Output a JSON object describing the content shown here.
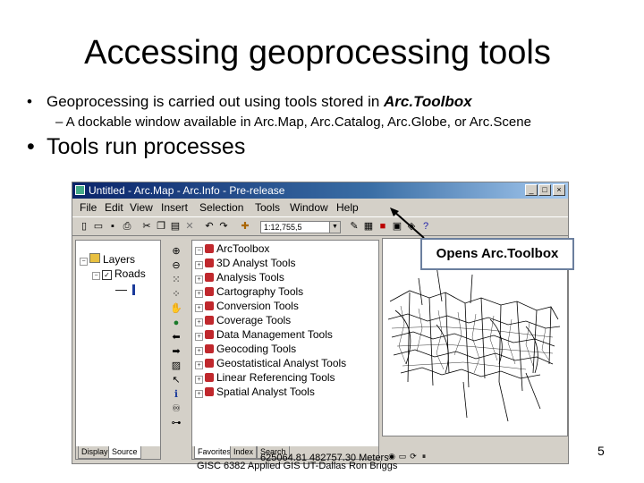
{
  "slide": {
    "title": "Accessing geoprocessing tools",
    "bullet1_prefix": "Geoprocessing is carried out using tools stored in ",
    "bullet1_emphasis": "Arc.Toolbox",
    "bullet2": "– A dockable window available in Arc.Map, Arc.Catalog, Arc.Globe, or Arc.Scene",
    "bullet3": "Tools run processes",
    "bullet_glyph": "•",
    "callout": "Opens Arc.Toolbox",
    "footer": "GISC 6382 Applied GIS   UT-Dallas   Ron Briggs",
    "page_number": "5"
  },
  "window": {
    "title": "Untitled - Arc.Map - Arc.Info - Pre-release",
    "menus": [
      "File",
      "Edit",
      "View",
      "Insert",
      "Selection",
      "Tools",
      "Window",
      "Help"
    ],
    "scale": "1:12,755,5",
    "toc": {
      "layers_label": "Layers",
      "roads_label": "Roads",
      "tabs": [
        "Display",
        "Source"
      ]
    },
    "arctoolbox": {
      "root": "ArcToolbox",
      "items": [
        "3D Analyst Tools",
        "Analysis Tools",
        "Cartography Tools",
        "Conversion Tools",
        "Coverage Tools",
        "Data Management Tools",
        "Geocoding Tools",
        "Geostatistical Analyst Tools",
        "Linear Referencing Tools",
        "Spatial Analyst Tools"
      ],
      "tabs": [
        "Favorites",
        "Index",
        "Search"
      ]
    },
    "status": "625064.81  482757.30 Meters"
  },
  "colors": {
    "titlebar": "#0a246a",
    "toolbox_icon": "#c0282d",
    "callout_border": "#6b7f9e"
  }
}
